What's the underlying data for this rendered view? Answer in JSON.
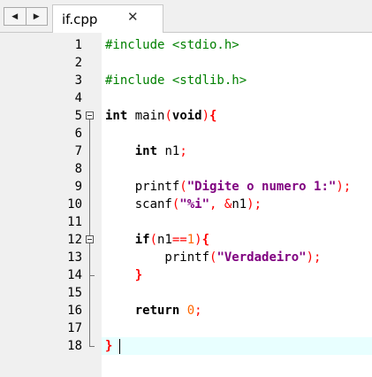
{
  "tabbar": {
    "nav_prev_label": "◀",
    "nav_next_label": "▶",
    "tab": {
      "label": "if.cpp",
      "close_label": "✕"
    }
  },
  "editor": {
    "line_numbers": [
      "1",
      "2",
      "3",
      "4",
      "5",
      "6",
      "7",
      "8",
      "9",
      "10",
      "11",
      "12",
      "13",
      "14",
      "15",
      "16",
      "17",
      "18"
    ],
    "lines": [
      [
        {
          "t": "#include <stdio.h>",
          "c": "pp"
        }
      ],
      [],
      [
        {
          "t": "#include <stdlib.h>",
          "c": "pp"
        }
      ],
      [],
      [
        {
          "t": "int",
          "c": "kw"
        },
        {
          "t": " main",
          "c": ""
        },
        {
          "t": "(",
          "c": "op"
        },
        {
          "t": "void",
          "c": "kw"
        },
        {
          "t": ")",
          "c": "op"
        },
        {
          "t": "{",
          "c": "br"
        }
      ],
      [],
      [
        {
          "t": "    ",
          "c": ""
        },
        {
          "t": "int",
          "c": "kw"
        },
        {
          "t": " n1",
          "c": ""
        },
        {
          "t": ";",
          "c": "op"
        }
      ],
      [],
      [
        {
          "t": "    printf",
          "c": ""
        },
        {
          "t": "(",
          "c": "op"
        },
        {
          "t": "\"Digite o numero 1:\"",
          "c": "str"
        },
        {
          "t": ");",
          "c": "op"
        }
      ],
      [
        {
          "t": "    scanf",
          "c": ""
        },
        {
          "t": "(",
          "c": "op"
        },
        {
          "t": "\"%i\"",
          "c": "str"
        },
        {
          "t": ", &",
          "c": "op"
        },
        {
          "t": "n1",
          "c": ""
        },
        {
          "t": ");",
          "c": "op"
        }
      ],
      [],
      [
        {
          "t": "    ",
          "c": ""
        },
        {
          "t": "if",
          "c": "kw"
        },
        {
          "t": "(",
          "c": "op"
        },
        {
          "t": "n1",
          "c": ""
        },
        {
          "t": "==",
          "c": "op"
        },
        {
          "t": "1",
          "c": "num"
        },
        {
          "t": ")",
          "c": "op"
        },
        {
          "t": "{",
          "c": "br"
        }
      ],
      [
        {
          "t": "        printf",
          "c": ""
        },
        {
          "t": "(",
          "c": "op"
        },
        {
          "t": "\"Verdadeiro\"",
          "c": "str"
        },
        {
          "t": ");",
          "c": "op"
        }
      ],
      [
        {
          "t": "    ",
          "c": ""
        },
        {
          "t": "}",
          "c": "br"
        }
      ],
      [],
      [
        {
          "t": "    ",
          "c": ""
        },
        {
          "t": "return",
          "c": "kw"
        },
        {
          "t": " ",
          "c": ""
        },
        {
          "t": "0",
          "c": "num"
        },
        {
          "t": ";",
          "c": "op"
        }
      ],
      [],
      [
        {
          "t": "}",
          "c": "br"
        }
      ]
    ],
    "fold_markers": [
      5,
      12
    ],
    "current_line": 18
  },
  "colors": {
    "preprocessor": "#008000",
    "string": "#800080",
    "operator": "#ff0000",
    "number": "#ff6600",
    "current_line_bg": "#e8ffff",
    "gutter_bg": "#f0f0f0"
  }
}
